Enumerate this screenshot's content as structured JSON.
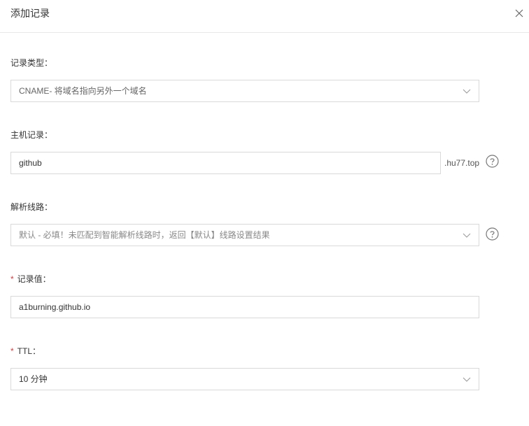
{
  "dialog": {
    "title": "添加记录"
  },
  "form": {
    "record_type": {
      "label": "记录类型：",
      "value": "CNAME- 将域名指向另外一个域名"
    },
    "host": {
      "label": "主机记录：",
      "value": "github",
      "suffix": ".hu77.top"
    },
    "line": {
      "label": "解析线路：",
      "value": "默认 - 必填！未匹配到智能解析线路时，返回【默认】线路设置结果"
    },
    "record_value": {
      "required_mark": "*",
      "label": "记录值：",
      "value": "a1burning.github.io"
    },
    "ttl": {
      "required_mark": "*",
      "label": "TTL：",
      "value": "10 分钟"
    }
  },
  "icons": {
    "close": "close-icon",
    "dropdown": "chevron-down-icon",
    "help": "question-circle-icon"
  }
}
